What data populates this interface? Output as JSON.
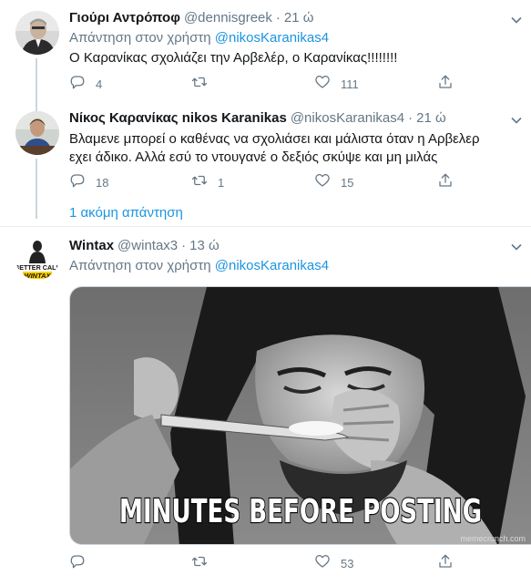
{
  "tweets": [
    {
      "name": "Γιούρι Αντρόποφ",
      "handle": "@dennisgreek",
      "separator": "·",
      "time": "21 ώ",
      "reply_prefix": "Απάντηση στον χρήστη",
      "reply_mention": "@nikosKaranikas4",
      "text": "Ο Καρανίκας σχολιάζει την Αρβελέρ, ο Καρανίκας!!!!!!!!",
      "replies": "4",
      "retweets": "",
      "likes": "111"
    },
    {
      "name": "Νίκος Καρανίκας nikos Karanikas",
      "handle": "@nikosKaranikas4",
      "separator": "·",
      "time": "21 ώ",
      "text": "Βλαμενε μπορεί ο καθένας να σχολιάσει και μάλιστα όταν η Αρβελερ εχει άδικο. Αλλά εσύ το ντουγανέ ο δεξιός σκύψε και μη μιλάς",
      "replies": "18",
      "retweets": "1",
      "likes": "15"
    },
    {
      "name": "Wintax",
      "handle": "@wintax3",
      "separator": "·",
      "time": "13 ώ",
      "reply_prefix": "Απάντηση στον χρήστη",
      "reply_mention": "@nikosKaranikas4",
      "replies": "",
      "retweets": "",
      "likes": "53",
      "avatar_text_top": "BETTER CALL",
      "avatar_text_bottom": "WINTAX",
      "media_caption": "MINUTES BEFORE POSTING",
      "media_watermark": "memecrunch.com"
    }
  ],
  "more_replies": "1 ακόμη απάντηση",
  "colors": {
    "link": "#1b95e0",
    "muted": "#657786",
    "line": "#ccd6dd",
    "divider": "#e6ecf0"
  },
  "icons": [
    "reply-icon",
    "retweet-icon",
    "like-icon",
    "share-icon",
    "caret-down-icon"
  ]
}
